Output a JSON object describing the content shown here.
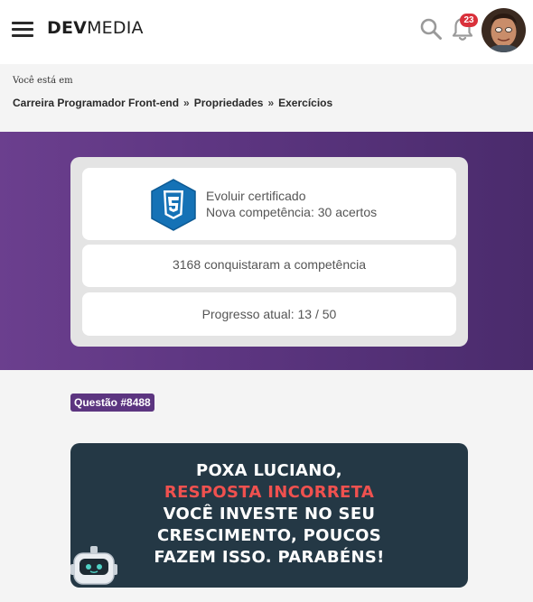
{
  "header": {
    "logo_bold": "DEV",
    "logo_light": "MEDIA",
    "notification_count": "23"
  },
  "breadcrumb": {
    "label": "Você está em",
    "items": [
      "Carreira Programador Front-end",
      "Propriedades",
      "Exercícios"
    ],
    "separator": "»"
  },
  "competence": {
    "title": "Evoluir certificado",
    "subtitle": "Nova competência: 30 acertos",
    "achievers": "3168 conquistaram a competência",
    "progress": "Progresso atual: 13 / 50"
  },
  "question": {
    "tag": "Questão #8488"
  },
  "result_banner": {
    "line1": "POXA LUCIANO,",
    "line2": "RESPOSTA INCORRETA",
    "line3": "VOCÊ INVESTE NO SEU",
    "line4": "CRESCIMENTO, POUCOS",
    "line5": "FAZEM ISSO. PARABÉNS!"
  },
  "icons": [
    "menu-icon",
    "search-icon",
    "bell-icon",
    "css3-icon",
    "robot-icon"
  ],
  "colors": {
    "brand_purple": "#5c3580",
    "badge_red": "#d9313b",
    "banner_bg": "#243845",
    "incorrect_red": "#f0514f",
    "css_blue": "#1572b6"
  }
}
